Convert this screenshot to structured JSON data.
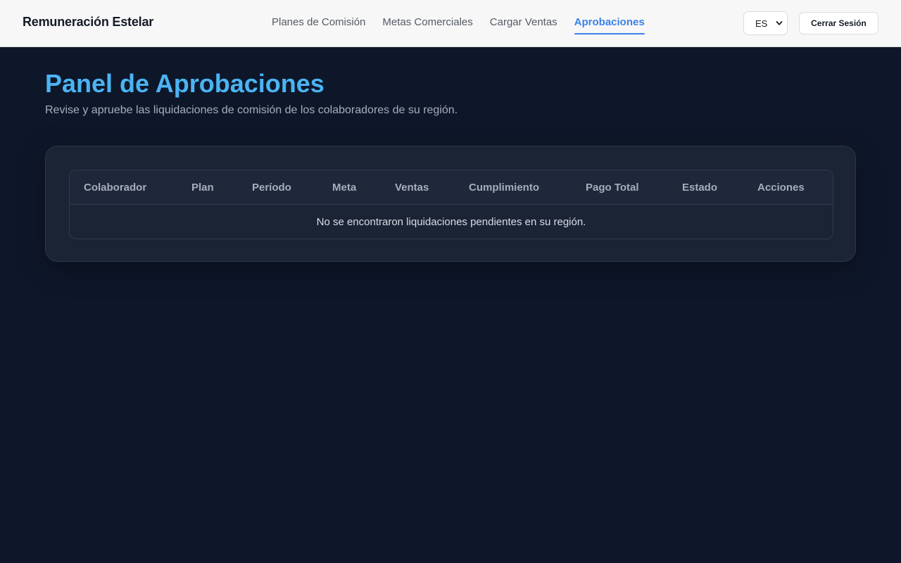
{
  "app": {
    "brand": "Remuneración Estelar"
  },
  "nav": {
    "items": [
      {
        "label": "Planes de Comisión",
        "active": false
      },
      {
        "label": "Metas Comerciales",
        "active": false
      },
      {
        "label": "Cargar Ventas",
        "active": false
      },
      {
        "label": "Aprobaciones",
        "active": true
      }
    ]
  },
  "header": {
    "language": {
      "selected": "ES",
      "icon": "chevron-down-icon"
    },
    "logout_label": "Cerrar Sesión"
  },
  "page": {
    "title": "Panel de Aprobaciones",
    "subtitle": "Revise y apruebe las liquidaciones de comisión de los colaboradores de su región."
  },
  "table": {
    "columns": [
      "Colaborador",
      "Plan",
      "Período",
      "Meta",
      "Ventas",
      "Cumplimiento",
      "Pago Total",
      "Estado",
      "Acciones"
    ],
    "rows": [],
    "empty_message": "No se encontraron liquidaciones pendientes en su región."
  },
  "colors": {
    "accent": "#3b82e8",
    "title": "#4bb4f3",
    "background": "#0e172a",
    "card": "#1b2435"
  }
}
